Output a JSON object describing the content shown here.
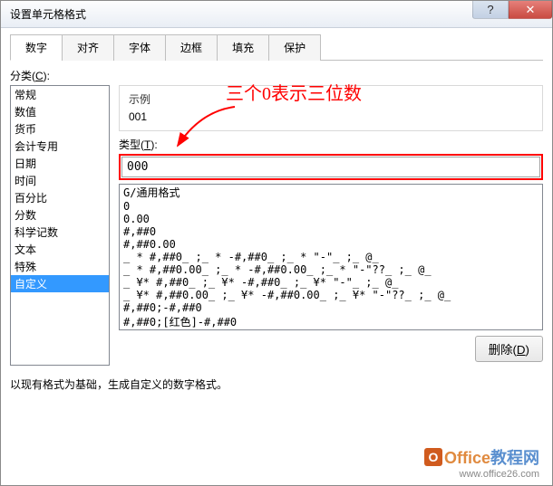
{
  "window": {
    "title": "设置单元格格式",
    "help": "?",
    "close": "✕"
  },
  "tabs": [
    "数字",
    "对齐",
    "字体",
    "边框",
    "填充",
    "保护"
  ],
  "activeTab": 0,
  "category": {
    "label": "分类(C):",
    "items": [
      "常规",
      "数值",
      "货币",
      "会计专用",
      "日期",
      "时间",
      "百分比",
      "分数",
      "科学记数",
      "文本",
      "特殊",
      "自定义"
    ],
    "selectedIndex": 11
  },
  "sample": {
    "label": "示例",
    "value": "001"
  },
  "type": {
    "label": "类型(T):",
    "value": "000"
  },
  "formats": [
    "G/通用格式",
    "0",
    "0.00",
    "#,##0",
    "#,##0.00",
    "_ * #,##0_ ;_ * -#,##0_ ;_ * \"-\"_ ;_ @_ ",
    "_ * #,##0.00_ ;_ * -#,##0.00_ ;_ * \"-\"??_ ;_ @_ ",
    "_ ¥* #,##0_ ;_ ¥* -#,##0_ ;_ ¥* \"-\"_ ;_ @_ ",
    "_ ¥* #,##0.00_ ;_ ¥* -#,##0.00_ ;_ ¥* \"-\"??_ ;_ @_ ",
    "#,##0;-#,##0",
    "#,##0;[红色]-#,##0"
  ],
  "deleteBtn": "删除(D)",
  "hint": "以现有格式为基础，生成自定义的数字格式。",
  "annotation": "三个0表示三位数",
  "watermark": {
    "brand_prefix": "Office",
    "brand_suffix": "教程网",
    "url": "www.office26.com",
    "logo_letter": "O"
  }
}
